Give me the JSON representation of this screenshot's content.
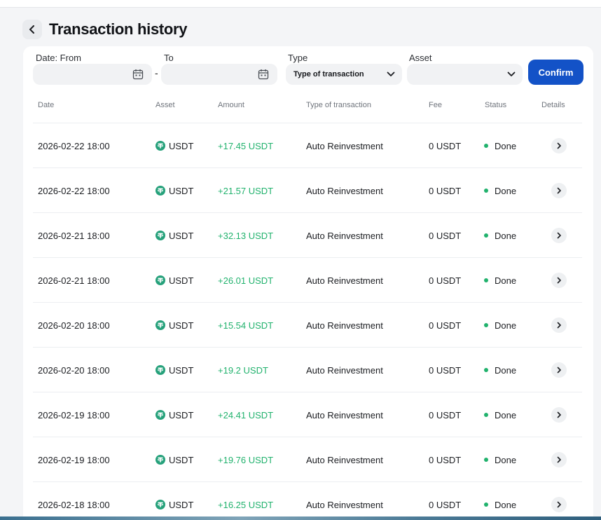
{
  "header": {
    "title": "Transaction history"
  },
  "filters": {
    "date_from_label": "Date: From",
    "date_from_value": "",
    "to_label": "To",
    "to_value": "",
    "separator": "-",
    "type_label": "Type",
    "type_value": "Type of transaction",
    "asset_label": "Asset",
    "asset_value": "",
    "confirm_label": "Confirm"
  },
  "table": {
    "columns": [
      "Date",
      "Asset",
      "Amount",
      "Type of transaction",
      "Fee",
      "Status",
      "Details"
    ],
    "rows": [
      {
        "date": "2026-02-22 18:00",
        "asset": "USDT",
        "amount": "+17.45 USDT",
        "type": "Auto Reinvestment",
        "fee": "0 USDT",
        "status": "Done"
      },
      {
        "date": "2026-02-22 18:00",
        "asset": "USDT",
        "amount": "+21.57 USDT",
        "type": "Auto Reinvestment",
        "fee": "0 USDT",
        "status": "Done"
      },
      {
        "date": "2026-02-21 18:00",
        "asset": "USDT",
        "amount": "+32.13 USDT",
        "type": "Auto Reinvestment",
        "fee": "0 USDT",
        "status": "Done"
      },
      {
        "date": "2026-02-21 18:00",
        "asset": "USDT",
        "amount": "+26.01 USDT",
        "type": "Auto Reinvestment",
        "fee": "0 USDT",
        "status": "Done"
      },
      {
        "date": "2026-02-20 18:00",
        "asset": "USDT",
        "amount": "+15.54 USDT",
        "type": "Auto Reinvestment",
        "fee": "0 USDT",
        "status": "Done"
      },
      {
        "date": "2026-02-20 18:00",
        "asset": "USDT",
        "amount": "+19.2 USDT",
        "type": "Auto Reinvestment",
        "fee": "0 USDT",
        "status": "Done"
      },
      {
        "date": "2026-02-19 18:00",
        "asset": "USDT",
        "amount": "+24.41 USDT",
        "type": "Auto Reinvestment",
        "fee": "0 USDT",
        "status": "Done"
      },
      {
        "date": "2026-02-19 18:00",
        "asset": "USDT",
        "amount": "+19.76 USDT",
        "type": "Auto Reinvestment",
        "fee": "0 USDT",
        "status": "Done"
      },
      {
        "date": "2026-02-18 18:00",
        "asset": "USDT",
        "amount": "+16.25 USDT",
        "type": "Auto Reinvestment",
        "fee": "0 USDT",
        "status": "Done"
      }
    ]
  },
  "icons": {
    "back": "chevron-left-icon",
    "calendar": "calendar-icon",
    "dropdown": "chevron-down-icon",
    "asset": "tether-icon",
    "details": "chevron-right-icon"
  },
  "colors": {
    "primary": "#1352c7",
    "positive": "#21b26d",
    "tether": "#26a17b",
    "background": "#f4f5f7"
  }
}
